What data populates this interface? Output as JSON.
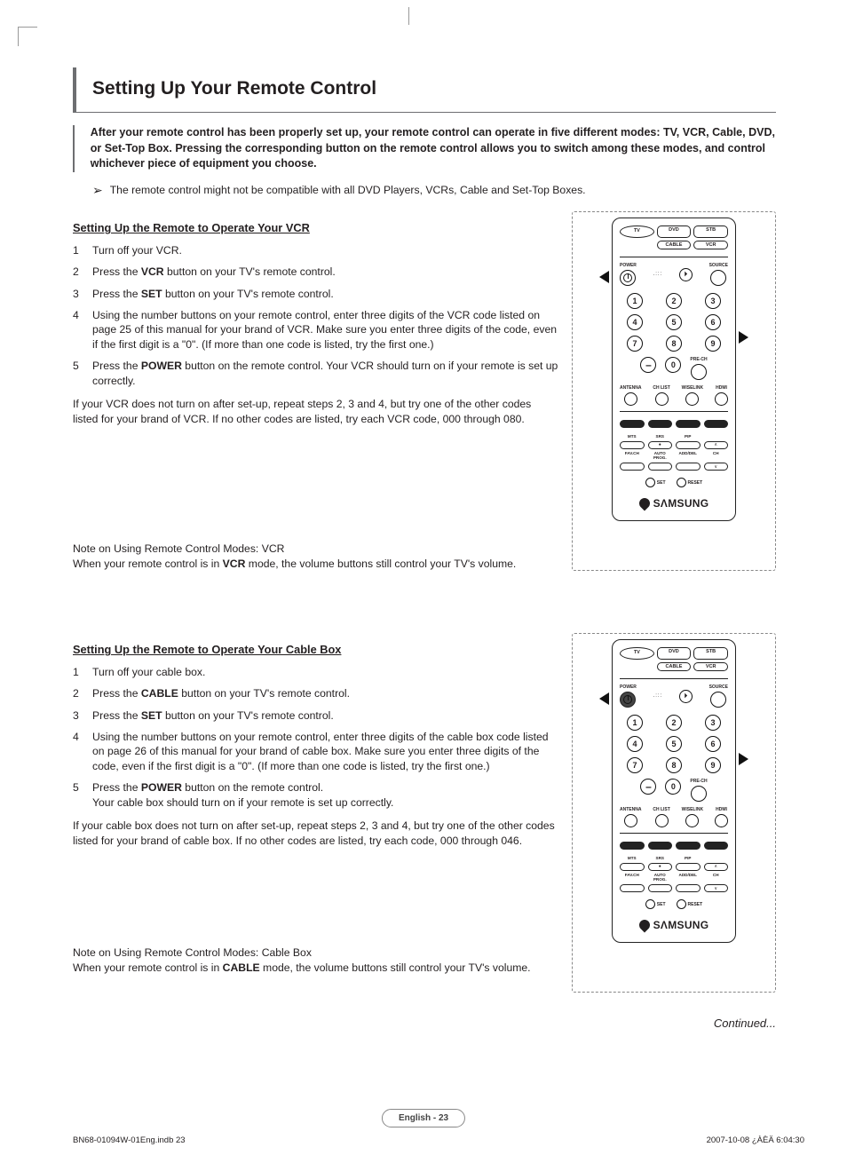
{
  "title": "Setting Up Your Remote Control",
  "intro": "After your remote control has been properly set up, your remote control can operate in five different modes: TV, VCR, Cable, DVD, or Set-Top Box. Pressing the corresponding button on the remote control allows you to switch among these modes, and control whichever piece of equipment you choose.",
  "compat_note": "The remote control might not be compatible with all DVD Players, VCRs, Cable and Set-Top Boxes.",
  "vcr": {
    "heading": "Setting Up the Remote to Operate Your VCR",
    "s1": "Turn off your VCR.",
    "s2_pre": "Press the ",
    "s2_bold": "VCR",
    "s2_post": " button on your TV's remote control.",
    "s3_pre": "Press the ",
    "s3_bold": "SET",
    "s3_post": " button on your TV's remote control.",
    "s4": "Using the number buttons on your remote control, enter three digits of the VCR code listed on page 25 of this manual for your brand of VCR. Make sure you enter three digits of the code, even if the first digit is a \"0\". (If more than one code is listed, try the first one.)",
    "s5_pre": "Press the ",
    "s5_bold": "POWER",
    "s5_post": " button on the remote control. Your VCR should turn on if your remote is set up correctly.",
    "fallback": "If your VCR does not turn on after set-up, repeat steps 2, 3 and 4, but try one of the other codes listed for your brand of VCR. If no other codes are listed, try each VCR code, 000 through 080.",
    "note_title": "Note on Using Remote Control Modes: VCR",
    "note_pre": "When your remote control is in ",
    "note_bold": "VCR",
    "note_post": " mode, the volume buttons still control your TV's volume."
  },
  "cable": {
    "heading": "Setting Up the Remote to Operate Your Cable Box",
    "s1": "Turn off your cable box.",
    "s2_pre": "Press the ",
    "s2_bold": "CABLE",
    "s2_post": " button on your TV's remote control.",
    "s3_pre": "Press the ",
    "s3_bold": "SET",
    "s3_post": " button on your TV's remote control.",
    "s4": "Using the number buttons on your remote control, enter three digits of the cable box code listed on page 26 of this manual for your brand of cable box. Make sure you enter three digits of the code, even if the first digit is a \"0\". (If more than one code is listed, try the first one.)",
    "s5a_pre": "Press the ",
    "s5a_bold": "POWER",
    "s5a_post": " button on the remote control.",
    "s5b": "Your cable box should turn on if your remote is set up correctly.",
    "fallback": "If your cable box does not turn on after set-up, repeat steps 2, 3 and 4, but try one of the other codes listed for your brand of cable box. If no other codes are listed, try each code, 000 through 046.",
    "note_title": "Note on Using Remote Control Modes: Cable Box",
    "note_pre": "When your remote control is in ",
    "note_bold": "CABLE",
    "note_post": " mode, the volume buttons still control your TV's volume."
  },
  "remote": {
    "modes": {
      "tv": "TV",
      "dvd": "DVD",
      "stb": "STB",
      "cable": "CABLE",
      "vcr": "VCR"
    },
    "power": "POWER",
    "source": "SOURCE",
    "k1": "1",
    "k2": "2",
    "k3": "3",
    "k4": "4",
    "k5": "5",
    "k6": "6",
    "k7": "7",
    "k8": "8",
    "k9": "9",
    "k0": "0",
    "prech": "PRE-CH",
    "antenna": "ANTENNA",
    "chlist": "CH LIST",
    "wiselink": "WISELINK",
    "hdmi": "HDMI",
    "mts": "MTS",
    "srs": "SRS",
    "pip": "PIP",
    "favch": "FAV.CH",
    "autoprog": "AUTO PROG.",
    "adddel": "ADD/DEL",
    "ch": "CH",
    "set": "SET",
    "reset": "RESET",
    "brand": "SΛMSUNG",
    "up": "∧",
    "down": "∨",
    "dot": "●"
  },
  "continued": "Continued...",
  "page_badge": "English - 23",
  "footer_left": "BN68-01094W-01Eng.indb   23",
  "footer_right": "2007-10-08   ¿ÀÈÄ 6:04:30"
}
